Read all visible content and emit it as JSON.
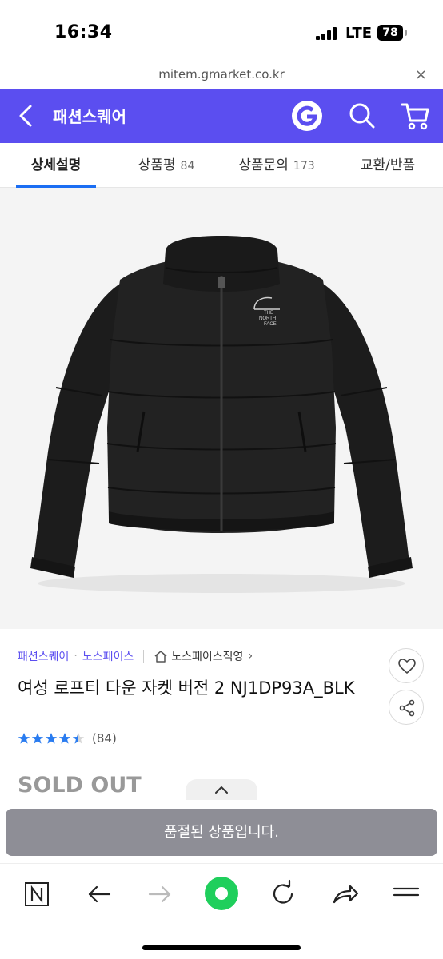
{
  "status_bar": {
    "time": "16:34",
    "network": "LTE",
    "battery": "78"
  },
  "url_bar": {
    "url": "mitem.gmarket.co.kr",
    "close": "×"
  },
  "header": {
    "title": "패션스퀘어"
  },
  "tabs": [
    {
      "label": "상세설명",
      "count": ""
    },
    {
      "label": "상품평",
      "count": "84"
    },
    {
      "label": "상품문의",
      "count": "173"
    },
    {
      "label": "교환/반품",
      "count": ""
    }
  ],
  "product": {
    "store": "패션스퀘어",
    "brand": "노스페이스",
    "official_store": "노스페이스직영",
    "title": "여성 로프티 다운 자켓 버전 2 NJ1DP93A_BLK",
    "rating": 4.5,
    "review_count": "(84)",
    "jacket_logo": [
      "THE",
      "NORTH",
      "FACE"
    ],
    "soldout_label": "SOLD OUT"
  },
  "soldout_bar": {
    "label": "품절된 상품입니다."
  },
  "colors": {
    "header": "#5b4ef0",
    "tab_active": "#1b6ef3",
    "star": "#2a7cf0",
    "browser_green": "#1fcf5c"
  }
}
